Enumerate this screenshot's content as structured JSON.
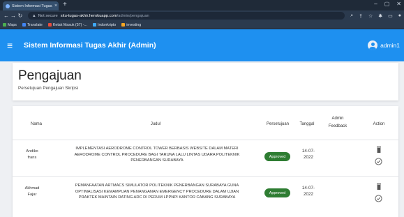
{
  "browser": {
    "tab_title": "Sistem Informasi Tugas Akhir (A...",
    "tab_close": "×",
    "new_tab": "+",
    "win_min": "–",
    "win_max": "▢",
    "win_close": "✕",
    "not_secure": "Not secure",
    "url_host": "situ-tugas-akhir.herokuapp.com",
    "url_path": "/admin/pengajuan",
    "bookmarks": [
      {
        "label": "Maps",
        "color": "#4caf50"
      },
      {
        "label": "Translate",
        "color": "#4285f4"
      },
      {
        "label": "Ketak Masuk (57) -...",
        "color": "#e74c3c"
      },
      {
        "label": "Indonkripto",
        "color": "#3fa9f5"
      },
      {
        "label": "investing",
        "color": "#f5a623"
      }
    ]
  },
  "header": {
    "title": "Sistem Informasi Tugas Akhir (Admin)",
    "username": "admin1"
  },
  "page": {
    "title": "Pengajuan",
    "subtitle": "Persetujuan Pengajuan Skripsi"
  },
  "table": {
    "columns": {
      "nama": "Nama",
      "judul": "Judul",
      "persetujuan": "Persetujuan",
      "tanggal": "Tanggal",
      "admin_feedback_1": "Admin",
      "admin_feedback_2": "Feedback",
      "action": "Action"
    },
    "rows": [
      {
        "nama_1": "Andiko",
        "nama_2": "frans",
        "judul_1": "IMPLEMENTASI AERODROME CONTROL TOWER BERBASIS WEBSITE DALAM MATERI",
        "judul_2": "AERODROME CONTROL PROCEDURE BAGI TARUNA LALU LINTAS UDARA POLITEKNIK",
        "judul_3": "PENERBANGAN SURABAYA",
        "status": "Approved",
        "tanggal_1": "14-07-",
        "tanggal_2": "2022"
      },
      {
        "nama_1": "Akhmad",
        "nama_2": "Fajar",
        "judul_1": "PEMANFAATAN ARTMACS SIMULATOR POLITEKNIK PENERBANGAN SURABAYA GUNA",
        "judul_2": "OPTIMALISASI KEMAMPUAN PENANGANAN EMERGENCY PROCEDURE DALAM UJIAN",
        "judul_3": "PRAKTEK MAINTAIN RATING ADC DI PERUM LPPNPI KANTOR CABANG SURABAYA",
        "status": "Approved",
        "tanggal_1": "14-07-",
        "tanggal_2": "2022"
      }
    ]
  },
  "colors": {
    "accent": "#1e90f0",
    "approved": "#2e7d32"
  }
}
